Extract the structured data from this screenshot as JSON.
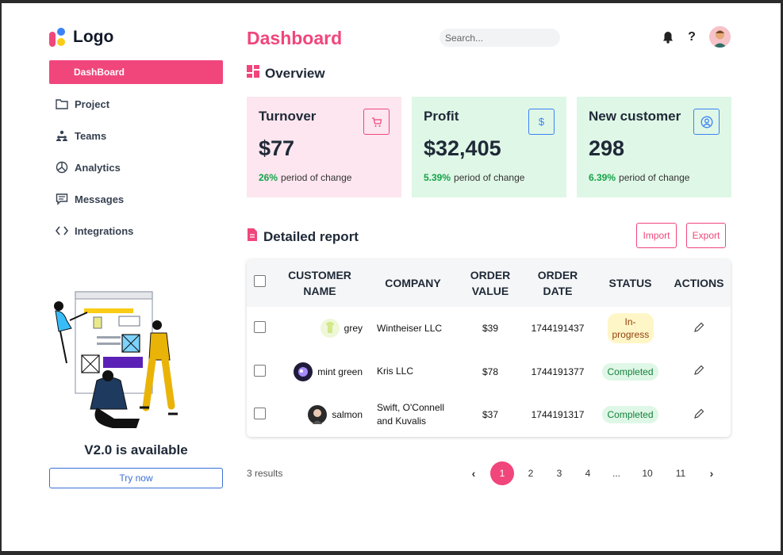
{
  "sidebar": {
    "logo_text": "Logo",
    "items": [
      {
        "label": "DashBoard",
        "icon": "grid-icon",
        "active": true
      },
      {
        "label": "Project",
        "icon": "folder-icon"
      },
      {
        "label": "Teams",
        "icon": "teams-icon"
      },
      {
        "label": "Analytics",
        "icon": "pie-chart-icon"
      },
      {
        "label": "Messages",
        "icon": "message-icon"
      },
      {
        "label": "Integrations",
        "icon": "code-icon"
      }
    ],
    "promo": {
      "title": "V2.0 is available",
      "button": "Try now"
    }
  },
  "header": {
    "title": "Dashboard",
    "search_placeholder": "Search...",
    "help": "?"
  },
  "overview": {
    "title": "Overview",
    "cards": [
      {
        "title": "Turnover",
        "value": "$77",
        "change": "26%",
        "change_label": "period of change",
        "icon": "cart-icon",
        "color": "#fde6ef"
      },
      {
        "title": "Profit",
        "value": "$32,405",
        "change": "5.39%",
        "change_label": "period of change",
        "icon": "dollar-icon",
        "color": "#dff7e6"
      },
      {
        "title": "New customer",
        "value": "298",
        "change": "6.39%",
        "change_label": "period of change",
        "icon": "user-circle-icon",
        "color": "#dff7e6"
      }
    ]
  },
  "report": {
    "title": "Detailed report",
    "import_label": "Import",
    "export_label": "Export",
    "columns": {
      "customer": "CUSTOMER NAME",
      "company": "COMPANY",
      "order_value": "ORDER VALUE",
      "order_date": "ORDER DATE",
      "status": "STATUS",
      "actions": "ACTIONS"
    },
    "rows": [
      {
        "name": "grey",
        "company": "Wintheiser LLC",
        "value": "$39",
        "date": "1744191437",
        "status": "In-progress"
      },
      {
        "name": "mint green",
        "company": "Kris LLC",
        "value": "$78",
        "date": "1744191377",
        "status": "Completed"
      },
      {
        "name": "salmon",
        "company": "Swift, O'Connell and Kuvalis",
        "value": "$37",
        "date": "1744191317",
        "status": "Completed"
      }
    ]
  },
  "pagination": {
    "results": "3 results",
    "pages": [
      "1",
      "2",
      "3",
      "4",
      "...",
      "10",
      "11"
    ],
    "current": "1",
    "prev": "‹",
    "next": "›"
  },
  "colors": {
    "accent": "#f0467b",
    "completed": "#15803d",
    "in_progress": "#92400e"
  }
}
